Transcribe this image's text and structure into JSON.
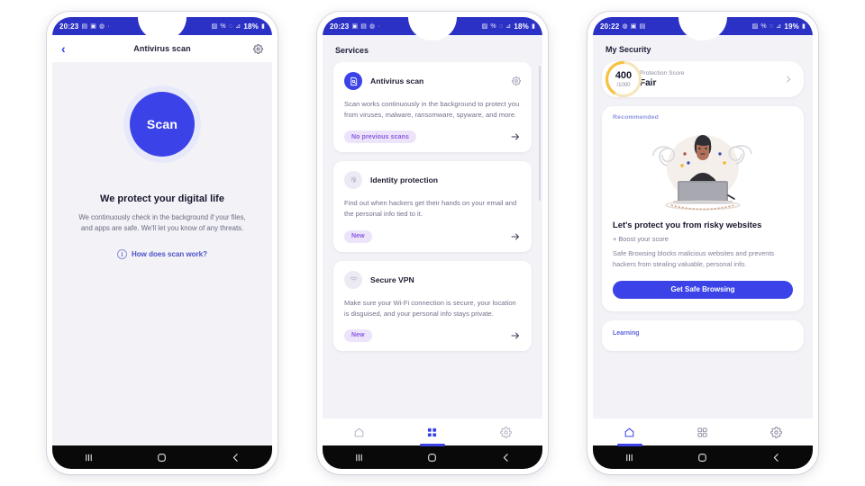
{
  "theme": {
    "accent": "#3b43e8",
    "statusbar_bg": "#2b31c4",
    "screen_bg": "#f2f2f7",
    "badge_bg": "#ece4fb",
    "badge_text": "#8d5ae0",
    "score_ring": "#f5c243"
  },
  "phone1": {
    "statusbar": {
      "time": "20:23",
      "left_icons": [
        "image-icon",
        "camera-icon",
        "whatsapp-icon",
        "dot-icon"
      ],
      "right_icons": [
        "alarm-icon",
        "wifi-off-icon",
        "mute-icon",
        "signal-icon"
      ],
      "battery": "18%"
    },
    "appbar": {
      "back_icon": "back-chevron-icon",
      "title": "Antivirus scan",
      "settings_icon": "gear-icon"
    },
    "scan_button": "Scan",
    "headline": "We protect your digital life",
    "description": "We continuously check in the background if your files, and apps are safe. We'll let you know of any threats.",
    "help_link": "How does scan work?",
    "help_icon": "info-icon"
  },
  "phone2": {
    "statusbar": {
      "time": "20:23",
      "left_icons": [
        "camera-icon",
        "image-icon",
        "whatsapp-icon",
        "dot-icon"
      ],
      "right_icons": [
        "alarm-icon",
        "wifi-off-icon",
        "mute-icon",
        "signal-icon"
      ],
      "battery": "18%"
    },
    "header": "Services",
    "cards": [
      {
        "icon": "antivirus-scan-icon",
        "title": "Antivirus scan",
        "description": "Scan works continuously in the background to protect you from viruses, malware, ransomware, spyware, and more.",
        "badge": "No previous scans",
        "settings_icon": "gear-icon",
        "arrow_icon": "arrow-right-icon"
      },
      {
        "icon": "fingerprint-icon",
        "title": "Identity protection",
        "description": "Find out when hackers get their hands on your email and the personal info tied to it.",
        "badge": "New",
        "arrow_icon": "arrow-right-icon"
      },
      {
        "icon": "vpn-wifi-icon",
        "title": "Secure VPN",
        "description": "Make sure your Wi-Fi connection is secure, your location is disguised, and your personal info stays private.",
        "badge": "New",
        "arrow_icon": "arrow-right-icon"
      }
    ],
    "bottomnav": {
      "active": "services",
      "items": [
        {
          "name": "home",
          "icon": "home-icon"
        },
        {
          "name": "services",
          "icon": "grid-icon"
        },
        {
          "name": "settings",
          "icon": "gear-icon"
        }
      ]
    }
  },
  "phone3": {
    "statusbar": {
      "time": "20:22",
      "left_icons": [
        "whatsapp-icon",
        "camera-icon",
        "image-icon"
      ],
      "right_icons": [
        "alarm-icon",
        "wifi-off-icon",
        "mute-icon",
        "signal-icon"
      ],
      "battery": "19%"
    },
    "header": "My Security",
    "score": {
      "value": "400",
      "max": "/1000",
      "label": "Protection Score",
      "status": "Fair",
      "chevron_icon": "chevron-right-icon"
    },
    "recommended": {
      "kicker": "Recommended",
      "illustration": "person-at-laptop-illustration",
      "title": "Let's protect you from risky websites",
      "boost": "+ Boost your score",
      "description": "Safe Browsing blocks malicious websites and prevents hackers from stealing valuable, personal info.",
      "cta": "Get Safe Browsing"
    },
    "learning": {
      "kicker": "Learning"
    },
    "bottomnav": {
      "active": "home",
      "items": [
        {
          "name": "home",
          "icon": "home-icon"
        },
        {
          "name": "services",
          "icon": "grid-icon"
        },
        {
          "name": "settings",
          "icon": "gear-icon"
        }
      ]
    }
  },
  "sysnav": {
    "recents_icon": "recents-icon",
    "home_icon": "home-square-icon",
    "back_icon": "back-icon"
  }
}
